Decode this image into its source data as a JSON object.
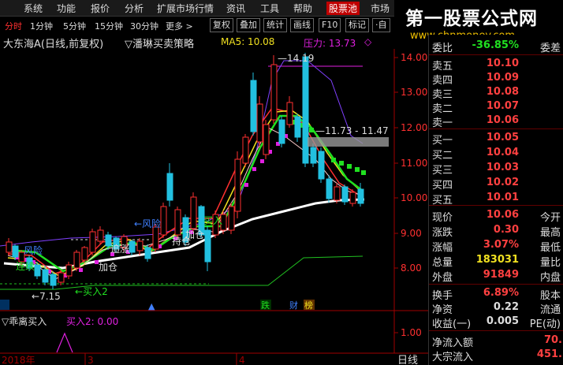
{
  "menu": [
    "系统",
    "功能",
    "报价",
    "分析",
    "扩展市场行情",
    "资讯",
    "工具",
    "帮助",
    "股票池",
    "市场"
  ],
  "watermark": {
    "title": "第一股票公式网",
    "url": "www.chnmoney.com"
  },
  "tabs": {
    "periods": [
      "分时",
      "1分钟",
      "5分钟",
      "15分钟",
      "30分钟",
      "更多 >"
    ],
    "buttons": [
      "复权",
      "叠加",
      "统计",
      "画线",
      "F10",
      "标记",
      "·自"
    ]
  },
  "title": {
    "stock": "大东海A(日线,前复权)",
    "formula": "▽潘琳买卖策略",
    "ma5": "MA5: 10.08",
    "pressure": "压力: 13.73",
    "pressure_mark": "◇"
  },
  "colors": {
    "up": "#ff3030",
    "down": "#22c0e0",
    "white": "#ffffff",
    "magenta": "#e020e0",
    "green": "#20e020",
    "yellow": "#f0e020"
  },
  "chart_labels": {
    "high": "14.19",
    "range": "11.73 - 11.47",
    "low": "7.15",
    "risk1": "风险",
    "risk2": "风险",
    "chase": "追涨",
    "addpos1": "加仓",
    "addpos2": "加仓",
    "hold": "持仓",
    "buy1": "买入",
    "buy2": "买入2",
    "lianxu": "连续",
    "markers": {
      "die": "跌",
      "cai": "财",
      "bang": "榜"
    }
  },
  "y_axis": {
    "ticks": [
      "14.00",
      "13.00",
      "12.00",
      "11.00",
      "10.00",
      "9.00",
      "8.00"
    ]
  },
  "sub": {
    "title": "▽乖离买入",
    "value": "买入2: 0.00",
    "ticks": [
      "1.00"
    ],
    "dates": [
      "2018年",
      "3",
      "4"
    ],
    "period_tab": "日线"
  },
  "quote": {
    "sell": [
      {
        "label": "卖五",
        "price": "10.10"
      },
      {
        "label": "卖四",
        "price": "10.09"
      },
      {
        "label": "卖三",
        "price": "10.08"
      },
      {
        "label": "卖二",
        "price": "10.07"
      },
      {
        "label": "卖一",
        "price": "10.06"
      }
    ],
    "buy": [
      {
        "label": "买一",
        "price": "10.05"
      },
      {
        "label": "买二",
        "price": "10.04"
      },
      {
        "label": "买三",
        "price": "10.03"
      },
      {
        "label": "买四",
        "price": "10.02"
      },
      {
        "label": "买五",
        "price": "10.01"
      }
    ],
    "top_row": {
      "label": "委比",
      "value": "-36.85%",
      "label2": "委差"
    },
    "stats": [
      {
        "label": "现价",
        "value": "10.06",
        "label2": "今开"
      },
      {
        "label": "涨跌",
        "value": "0.30",
        "label2": "最高"
      },
      {
        "label": "涨幅",
        "value": "3.07%",
        "label2": "最低"
      },
      {
        "label": "总量",
        "value": "183031",
        "label2": "量比"
      },
      {
        "label": "外盘",
        "value": "91849",
        "label2": "内盘"
      }
    ],
    "stats2": [
      {
        "label": "换手",
        "value": "6.89%",
        "label2": "股本"
      },
      {
        "label": "净资",
        "value": "0.22",
        "label2": "流通"
      },
      {
        "label": "收益(一)",
        "value": "0.005",
        "label2": "PE(动)"
      }
    ],
    "flow": [
      {
        "label": "净流入额",
        "value": "70."
      },
      {
        "label": "大宗流入",
        "value": "451."
      }
    ]
  }
}
